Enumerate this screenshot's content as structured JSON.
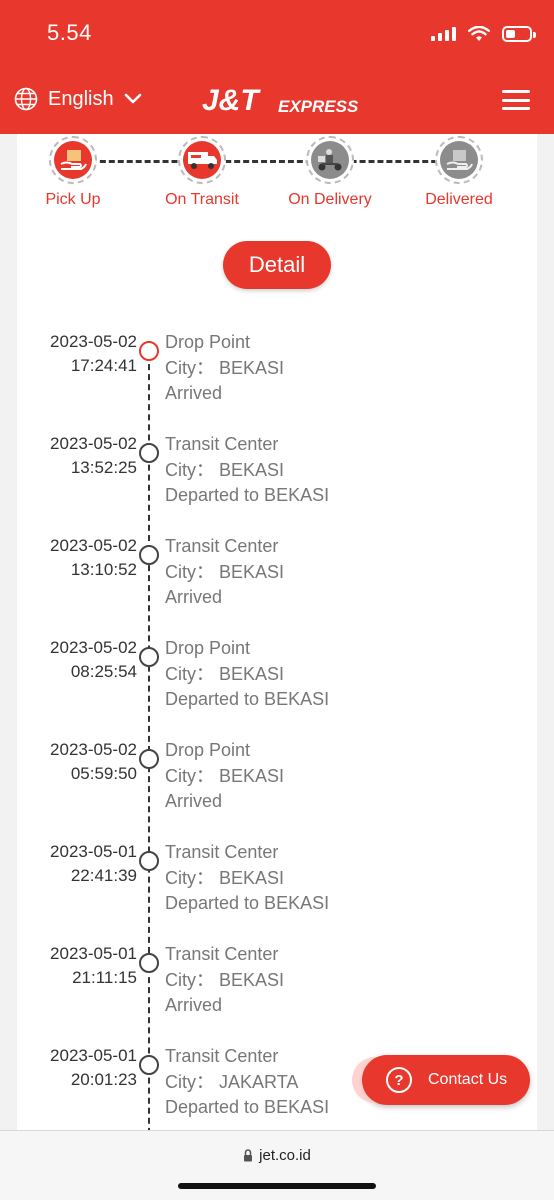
{
  "status_bar": {
    "time": "5.54"
  },
  "header": {
    "language": "English",
    "brand": {
      "main": "J&T",
      "sub": "EXPRESS"
    }
  },
  "progress": {
    "steps": [
      {
        "label": "Pick Up",
        "state": "active",
        "icon": "pickup-hand-icon"
      },
      {
        "label": "On Transit",
        "state": "active",
        "icon": "truck-icon"
      },
      {
        "label": "On Delivery",
        "state": "inactive",
        "icon": "courier-scooter-icon"
      },
      {
        "label": "Delivered",
        "state": "inactive",
        "icon": "delivered-box-icon"
      }
    ],
    "detail_button": "Detail"
  },
  "timeline": {
    "events": [
      {
        "date": "2023-05-02",
        "time": "17:24:41",
        "location": "Drop Point",
        "city": "City： BEKASI",
        "status": "Arrived"
      },
      {
        "date": "2023-05-02",
        "time": "13:52:25",
        "location": "Transit Center",
        "city": "City： BEKASI",
        "status": "Departed to BEKASI"
      },
      {
        "date": "2023-05-02",
        "time": "13:10:52",
        "location": "Transit Center",
        "city": "City： BEKASI",
        "status": "Arrived"
      },
      {
        "date": "2023-05-02",
        "time": "08:25:54",
        "location": "Drop Point",
        "city": "City： BEKASI",
        "status": "Departed to BEKASI"
      },
      {
        "date": "2023-05-02",
        "time": "05:59:50",
        "location": "Drop Point",
        "city": "City： BEKASI",
        "status": "Arrived"
      },
      {
        "date": "2023-05-01",
        "time": "22:41:39",
        "location": "Transit Center",
        "city": "City： BEKASI",
        "status": "Departed to BEKASI"
      },
      {
        "date": "2023-05-01",
        "time": "21:11:15",
        "location": "Transit Center",
        "city": "City： BEKASI",
        "status": "Arrived"
      },
      {
        "date": "2023-05-01",
        "time": "20:01:23",
        "location": "Transit Center",
        "city": "City： JAKARTA",
        "status": "Departed to BEKASI"
      }
    ]
  },
  "contact": {
    "label": "Contact Us"
  },
  "browser": {
    "url": "jet.co.id"
  },
  "colors": {
    "brand_red": "#e8372c",
    "text_gray": "#777777"
  }
}
